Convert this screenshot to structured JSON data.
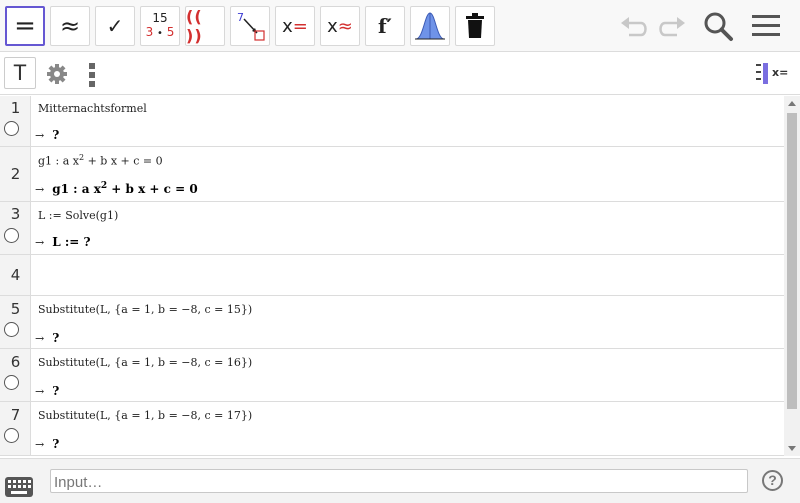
{
  "toolbar": {
    "buttons": [
      {
        "name": "evaluate-exact-button",
        "glyph": "="
      },
      {
        "name": "numeric-button",
        "glyph": "≈"
      },
      {
        "name": "keep-input-button",
        "glyph": "✓"
      },
      {
        "name": "factor-button",
        "top": "15",
        "bottom_left": "3",
        "bottom_dot": "•",
        "bottom_right": "5"
      },
      {
        "name": "expand-button",
        "glyph": "(( ))"
      },
      {
        "name": "substitute-button",
        "glyph": "7"
      },
      {
        "name": "solve-button",
        "glyph_x": "x",
        "glyph_op": "="
      },
      {
        "name": "solve-numerically-button",
        "glyph_x": "x",
        "glyph_op": "≈"
      },
      {
        "name": "derivative-button",
        "glyph": "f′"
      },
      {
        "name": "probability-calculator-button",
        "glyph": ""
      },
      {
        "name": "delete-button",
        "glyph": ""
      }
    ],
    "accent": "#6557d2",
    "red": "#d32f2f"
  },
  "subbar": {
    "text_tool": "T",
    "stylebar_label": "x="
  },
  "rows": [
    {
      "n": "1",
      "input": "Mitternachtsformel",
      "output": "?",
      "circle": true
    },
    {
      "n": "2",
      "input_pre": "g1 : a x",
      "input_sup": "2",
      "input_post": " + b x + c = 0",
      "output_pre": "g1 :  a x",
      "output_sup": "2",
      "output_post": " + b x + c = 0",
      "circle": false
    },
    {
      "n": "3",
      "input": "L := Solve(g1)",
      "output": "L := ?",
      "circle": true
    },
    {
      "n": "4",
      "input": "",
      "output": "",
      "circle": false
    },
    {
      "n": "5",
      "input": "Substitute(L, {a = 1, b = −8, c = 15})",
      "output": "?",
      "circle": true
    },
    {
      "n": "6",
      "input": "Substitute(L, {a = 1, b = −8, c = 16})",
      "output": "?",
      "circle": true
    },
    {
      "n": "7",
      "input": "Substitute(L, {a = 1, b = −8, c = 17})",
      "output": "?",
      "circle": true
    }
  ],
  "arrow": "→",
  "input_bar": {
    "placeholder": "Input…",
    "help": "?"
  }
}
